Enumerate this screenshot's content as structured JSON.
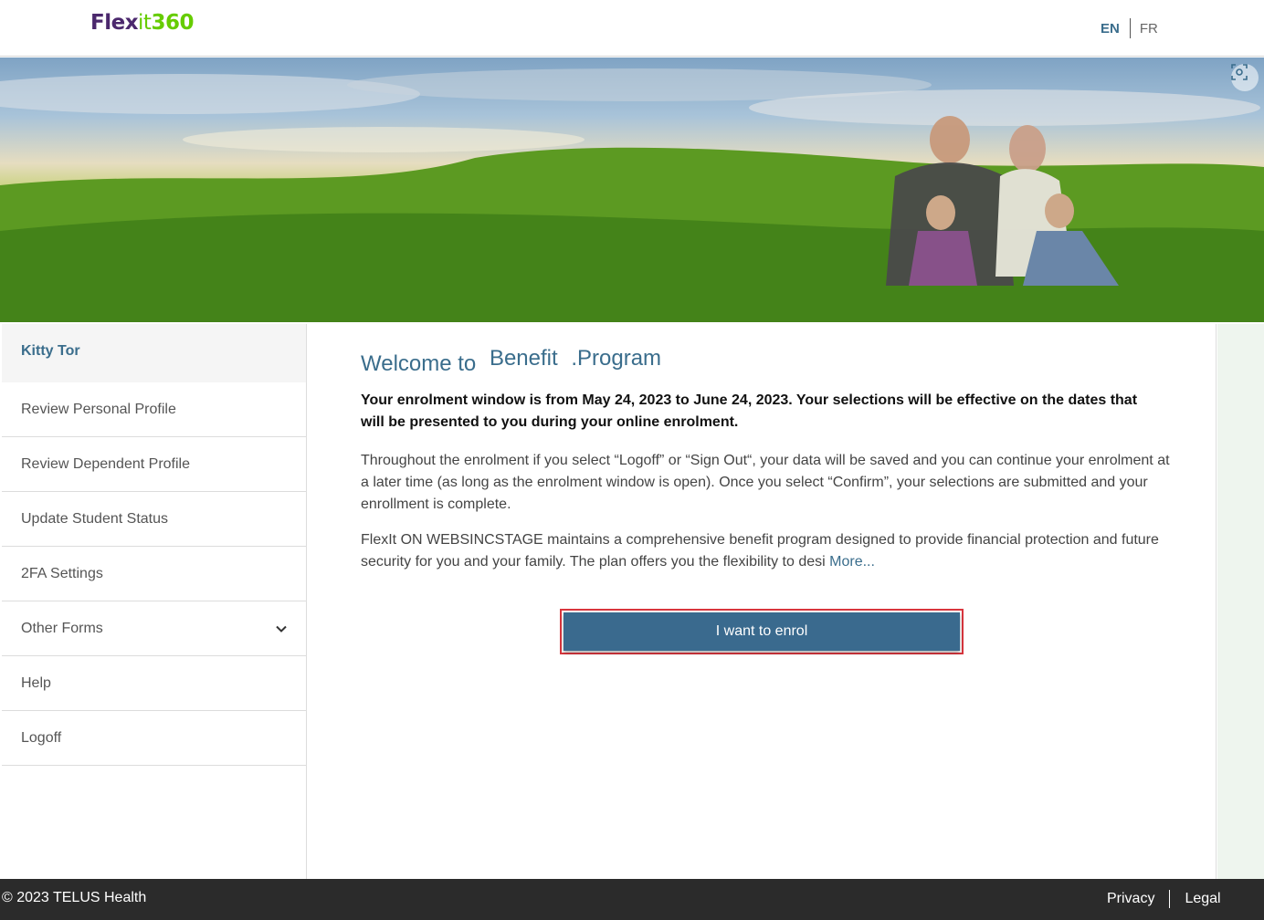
{
  "header": {
    "logo": {
      "part1": "Flex",
      "part2": "it",
      "part3": "360"
    },
    "lang_en": "EN",
    "lang_fr": "FR"
  },
  "sidebar": {
    "user_name": "Kitty Tor",
    "items": [
      {
        "label": "Review Personal Profile"
      },
      {
        "label": "Review Dependent Profile"
      },
      {
        "label": "Update Student Status"
      },
      {
        "label": "2FA Settings"
      },
      {
        "label": "Other Forms"
      },
      {
        "label": "Help"
      },
      {
        "label": "Logoff"
      }
    ]
  },
  "main": {
    "title_part1": "Welcome to",
    "title_part2": "Benefit",
    "title_part3": ".Program",
    "intro": "Your enrolment window is from May 24, 2023 to June 24, 2023. Your selections will be effective on the dates that will be presented to you during your online enrolment.",
    "paragraph1": "Throughout the enrolment if you select “Logoff” or “Sign Out“, your data will be saved and you can continue your enrolment at a later time (as long as the enrolment window is open). Once you select “Confirm”, your selections are submitted and your enrollment is complete.",
    "paragraph2": "FlexIt ON WEBSINCSTAGE maintains a comprehensive benefit program designed to provide financial protection and future security for you and your family.  The plan offers you the flexibility to desi",
    "more_link": "More...",
    "enrol_button": "I want to enrol"
  },
  "footer": {
    "copyright": "© 2023 TELUS Health",
    "privacy": "Privacy",
    "legal": "Legal"
  },
  "colors": {
    "accent": "#3a6d8c",
    "button": "#3a6a8e",
    "highlight": "#d9363e",
    "footer": "#2b2b2b"
  }
}
